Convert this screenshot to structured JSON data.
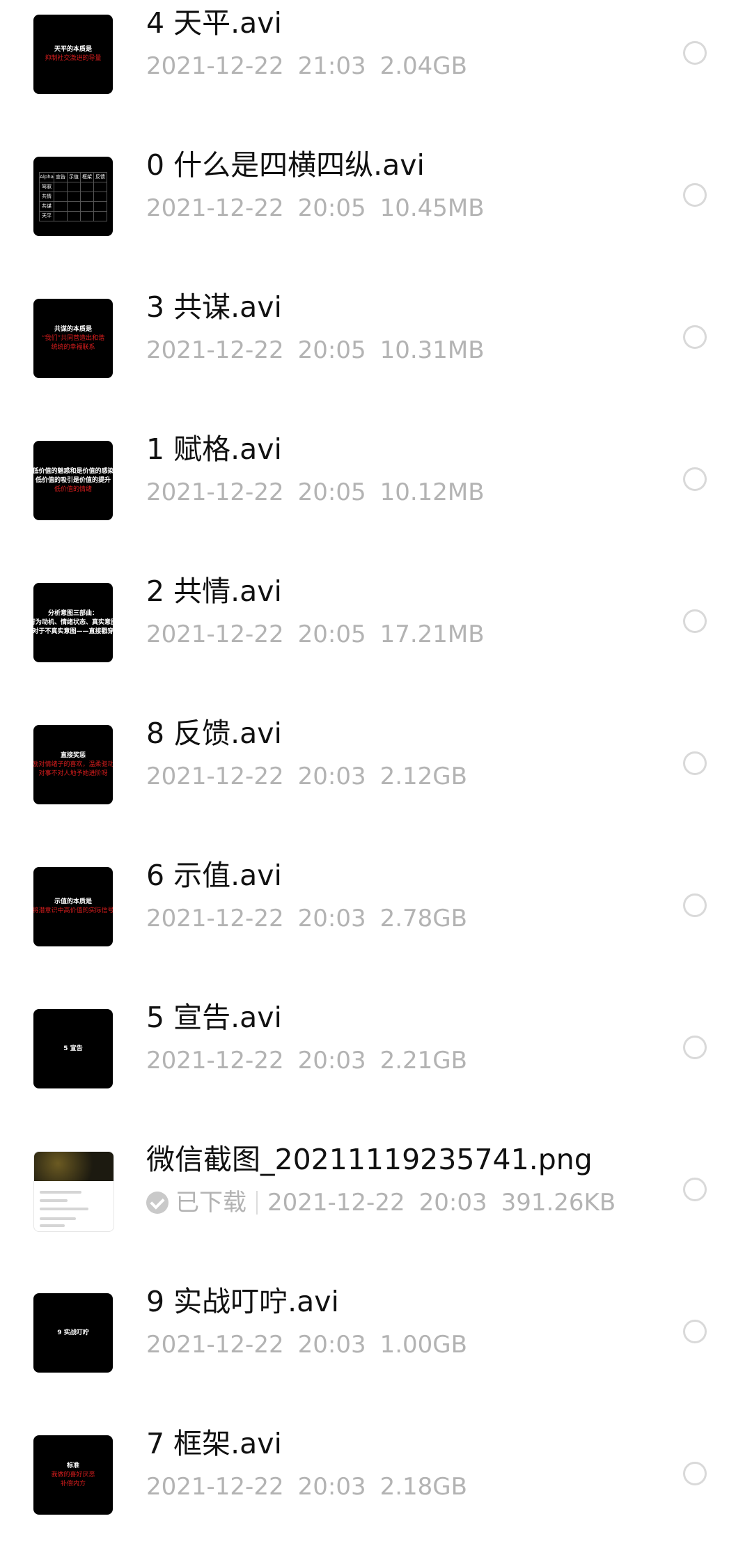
{
  "files": [
    {
      "name": "4 天平.avi",
      "date": "2021-12-22",
      "time": "21:03",
      "size": "2.04GB",
      "thumb": {
        "lines": [
          {
            "text": "天平的本质是",
            "cls": "white"
          },
          {
            "text": "抑制社交激进的导量",
            "cls": "red"
          }
        ]
      }
    },
    {
      "name": "0 什么是四横四纵.avi",
      "date": "2021-12-22",
      "time": "20:05",
      "size": "10.45MB",
      "thumb": {
        "table": {
          "header": [
            "Alpha",
            "宣告",
            "示值",
            "框架",
            "反馈"
          ],
          "rows": [
            "驾驭",
            "共情",
            "共谋",
            "天平"
          ]
        }
      }
    },
    {
      "name": "3 共谋.avi",
      "date": "2021-12-22",
      "time": "20:05",
      "size": "10.31MB",
      "thumb": {
        "lines": [
          {
            "text": "共谋的本质是",
            "cls": "white"
          },
          {
            "text": "“我们”共同营造出和谐",
            "cls": "red"
          },
          {
            "text": "统统的幸福联系",
            "cls": "red"
          }
        ]
      }
    },
    {
      "name": "1 赋格.avi",
      "date": "2021-12-22",
      "time": "20:05",
      "size": "10.12MB",
      "thumb": {
        "lines": [
          {
            "text": "低价值的魅惑和是价值的感染",
            "cls": "white"
          },
          {
            "text": "低价值的吸引是价值的提升",
            "cls": "white"
          },
          {
            "text": "低价值的情绪",
            "cls": "red"
          }
        ]
      }
    },
    {
      "name": "2 共情.avi",
      "date": "2021-12-22",
      "time": "20:05",
      "size": "17.21MB",
      "thumb": {
        "lines": [
          {
            "text": "分析意图三部曲：",
            "cls": "white"
          },
          {
            "text": "行为动机、情绪状态、真实意图",
            "cls": "white"
          },
          {
            "text": "对于不真实意图——直接戳穿",
            "cls": "white"
          }
        ]
      }
    },
    {
      "name": "8 反馈.avi",
      "date": "2021-12-22",
      "time": "20:03",
      "size": "2.12GB",
      "thumb": {
        "lines": [
          {
            "text": "直接奖惩",
            "cls": "white"
          },
          {
            "text": "奖励对情绪子的喜欢，温柔驱动情",
            "cls": "red"
          },
          {
            "text": "对事不对人地予她进阶呀",
            "cls": "red"
          }
        ]
      }
    },
    {
      "name": "6 示值.avi",
      "date": "2021-12-22",
      "time": "20:03",
      "size": "2.78GB",
      "thumb": {
        "lines": [
          {
            "text": "示值的本质是",
            "cls": "white"
          },
          {
            "text": "将潜意识中高价值的实际信号",
            "cls": "red"
          }
        ]
      }
    },
    {
      "name": "5 宣告.avi",
      "date": "2021-12-22",
      "time": "20:03",
      "size": "2.21GB",
      "thumb": {
        "lines": [
          {
            "text": "5 宣告",
            "cls": "white"
          }
        ]
      }
    },
    {
      "name": "微信截图_20211119235741.png",
      "date": "2021-12-22",
      "time": "20:03",
      "size": "391.26KB",
      "downloaded": "已下载",
      "thumb": {
        "png": true
      }
    },
    {
      "name": "9 实战叮咛.avi",
      "date": "2021-12-22",
      "time": "20:03",
      "size": "1.00GB",
      "thumb": {
        "lines": [
          {
            "text": "9 实战叮咛",
            "cls": "white"
          }
        ]
      }
    },
    {
      "name": "7 框架.avi",
      "date": "2021-12-22",
      "time": "20:03",
      "size": "2.18GB",
      "thumb": {
        "lines": [
          {
            "text": "标准",
            "cls": "white"
          },
          {
            "text": "我做的喜好厌恶",
            "cls": "red"
          },
          {
            "text": "补偿内方",
            "cls": "red"
          }
        ]
      }
    }
  ]
}
